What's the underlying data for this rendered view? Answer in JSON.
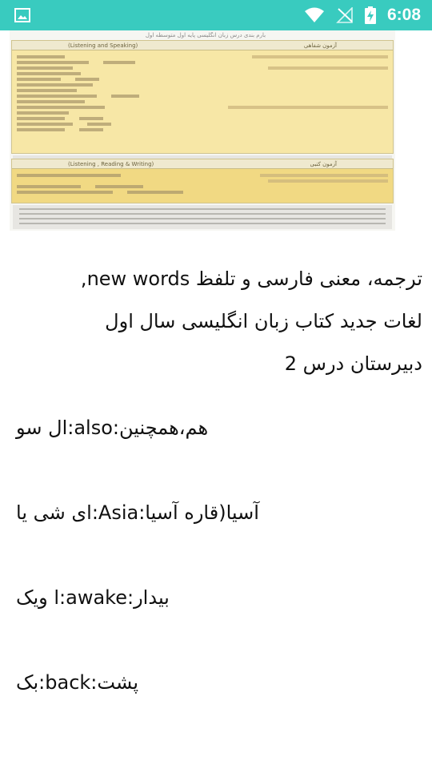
{
  "status_bar": {
    "time": "6:08",
    "icons": [
      "image-icon",
      "wifi-icon",
      "no-signal-icon",
      "battery-charging-icon"
    ],
    "background": "#39cbbf"
  },
  "article_image": {
    "caption": "بارم بندی درس زبان انگلیسی پایه اول متوسطه اول",
    "panels": [
      {
        "title": "(Listening and Speaking)",
        "subtitle": "آزمون شفاهی"
      },
      {
        "title": "(Listening , Reading & Writing)",
        "subtitle": "آزمون کتبی"
      }
    ]
  },
  "content": {
    "title_lines": [
      "ترجمه، معنی فارسی و تلفظ new words,",
      "لغات جدید کتاب زبان انگلیسی سال اول",
      "دبیرستان درس 2"
    ],
    "entries": [
      "هم،همچنین:also:ال سو",
      "آسیا(قاره آسیا:Asia:ای شی یا",
      "بیدار:awake:ا ویک",
      "پشت:back:بک"
    ]
  }
}
